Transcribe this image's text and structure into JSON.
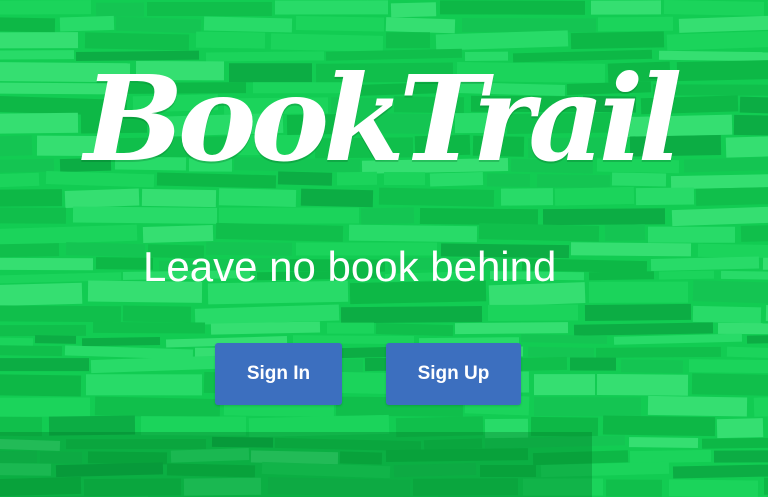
{
  "brand": {
    "logo_text": "BookTrail",
    "tagline": "Leave no book behind"
  },
  "actions": {
    "sign_in_label": "Sign In",
    "sign_up_label": "Sign Up"
  },
  "colors": {
    "background": "#12cc52",
    "button": "#3c6fbf",
    "text": "#ffffff"
  }
}
